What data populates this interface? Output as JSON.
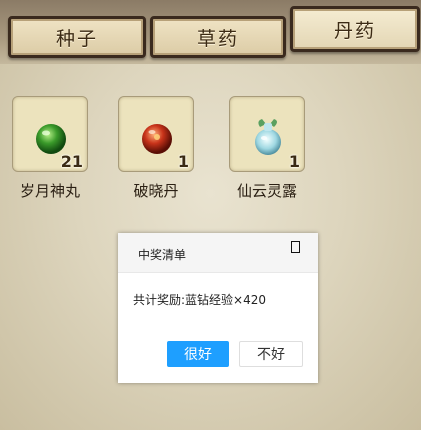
{
  "tabs": [
    {
      "label": "种子"
    },
    {
      "label": "草药"
    },
    {
      "label": "丹药"
    }
  ],
  "items": [
    {
      "name": "岁月神丸",
      "count": "21",
      "icon": "green-pill-icon",
      "color": "#3a9a2a"
    },
    {
      "name": "破晓丹",
      "count": "1",
      "icon": "red-pill-icon",
      "color": "#c8331a"
    },
    {
      "name": "仙云灵露",
      "count": "1",
      "icon": "dew-bottle-icon",
      "color": "#6fc0d0"
    }
  ],
  "dialog": {
    "title": "中奖清单",
    "message": "共计奖励:蓝钻经验×420",
    "ok_label": "很好",
    "cancel_label": "不好",
    "ok_color": "#1e9fff"
  }
}
